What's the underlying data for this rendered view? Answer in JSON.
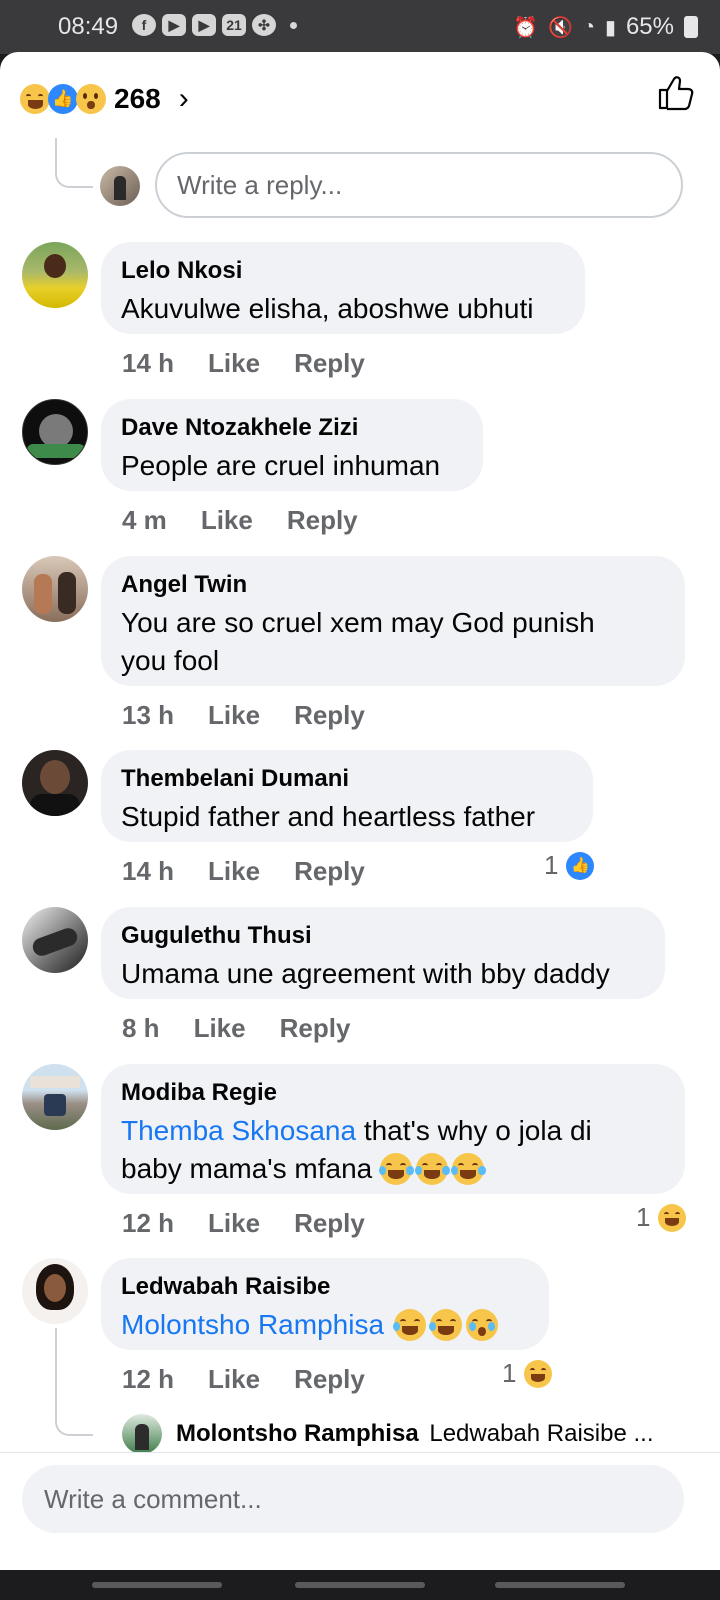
{
  "status_bar": {
    "time": "08:49",
    "battery": "65%",
    "calendar_badge": "21"
  },
  "reactions_header": {
    "count": "268",
    "emojis": [
      "haha-emoji",
      "like-emoji",
      "wow-emoji"
    ]
  },
  "reply_box": {
    "placeholder": "Write a reply..."
  },
  "comments": [
    {
      "name": "Lelo Nkosi",
      "text": "Akuvulwe elisha, aboshwe ubhuti",
      "time": "14 h",
      "like": "Like",
      "reply": "Reply"
    },
    {
      "name": "Dave Ntozakhele Zizi",
      "text": "People are cruel inhuman",
      "time": "4 m",
      "like": "Like",
      "reply": "Reply"
    },
    {
      "name": "Angel Twin",
      "text_line1": "You are so cruel xem may God punish",
      "text_line2": "you fool",
      "time": "13 h",
      "like": "Like",
      "reply": "Reply"
    },
    {
      "name": "Thembelani Dumani",
      "text": "Stupid father and heartless father",
      "time": "14 h",
      "like": "Like",
      "reply": "Reply",
      "reaction_count": "1"
    },
    {
      "name": "Gugulethu Thusi",
      "text": "Umama une agreement with bby daddy",
      "time": "8 h",
      "like": "Like",
      "reply": "Reply"
    },
    {
      "name": "Modiba Regie",
      "mention": "Themba Skhosana",
      "text_rest": " that's why o jola di",
      "text_line2": "baby mama's mfana",
      "time": "12 h",
      "like": "Like",
      "reply": "Reply",
      "reaction_count": "1"
    },
    {
      "name": "Ledwabah Raisibe",
      "mention": "Molontsho Ramphisa",
      "time": "12 h",
      "like": "Like",
      "reply": "Reply",
      "reaction_count": "1"
    }
  ],
  "nested_reply": {
    "name": "Molontsho Ramphisa",
    "text": "Ledwabah Raisibe ..."
  },
  "comment_box": {
    "placeholder": "Write a comment..."
  },
  "colors": {
    "link": "#1877f2",
    "bubble": "#f0f2f5",
    "meta": "#65676b"
  }
}
